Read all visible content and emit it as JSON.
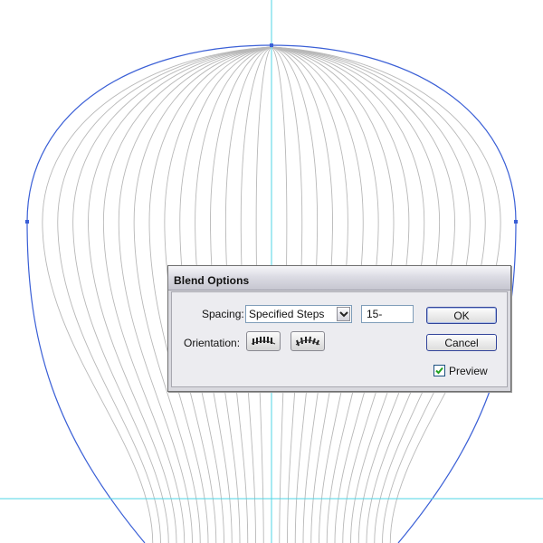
{
  "dialog": {
    "title": "Blend Options",
    "spacing_label": "Spacing:",
    "spacing_value": "Specified Steps",
    "steps_value": "15-",
    "orientation_label": "Orientation:",
    "ok_label": "OK",
    "cancel_label": "Cancel",
    "preview_label": "Preview",
    "preview_checked": true
  },
  "canvas": {
    "guide_color": "#4fd6e6",
    "path_color": "#3a5fd6",
    "blend_line_color": "#b8b8b8"
  }
}
